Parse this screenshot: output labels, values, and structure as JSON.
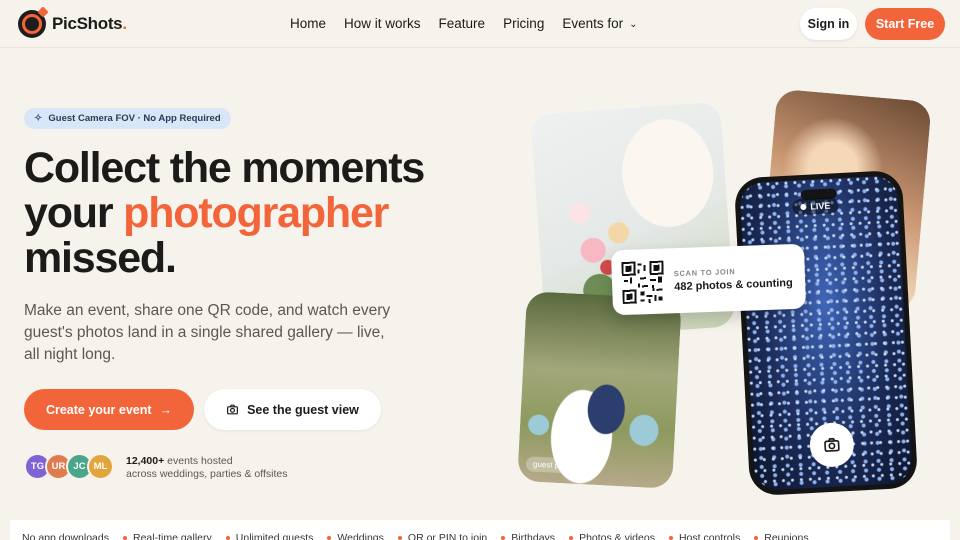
{
  "brand": {
    "name": "PicShots",
    "dot": ".",
    "accent": "#f2643a"
  },
  "nav": {
    "links": [
      "Home",
      "How it works",
      "Feature",
      "Pricing",
      "Events for"
    ],
    "signin_label": "Sign in",
    "start_label": "Start Free"
  },
  "hero": {
    "badge": "Guest Camera FOV · No App Required",
    "headline_1": "Collect the moments",
    "headline_2a": "your ",
    "headline_2b": "photographer",
    "headline_3": "missed.",
    "subcopy": "Make an event, share one QR code, and watch every guest's photos land in a single shared gallery — live, all night long.",
    "cta_primary": "Create your event",
    "cta_secondary": "See the guest view",
    "avatars": [
      {
        "initials": "TG",
        "color": "#7f63d6"
      },
      {
        "initials": "UR",
        "color": "#e07a4f"
      },
      {
        "initials": "JC",
        "color": "#4aa58a"
      },
      {
        "initials": "ML",
        "color": "#e3a43b"
      }
    ],
    "proof_count": "12,400+",
    "proof_line1": " events hosted",
    "proof_line2": "across weddings, parties & offsites"
  },
  "visual": {
    "live_label": "LIVE",
    "qr_label": "SCAN TO JOIN",
    "qr_count": "482 photos & counting",
    "guest_tag": "guest photo"
  },
  "ticker": [
    "No app downloads",
    "Real-time gallery",
    "Unlimited guests",
    "Weddings",
    "QR or PIN to join",
    "Birthdays",
    "Photos & videos",
    "Host controls",
    "Reunions"
  ]
}
